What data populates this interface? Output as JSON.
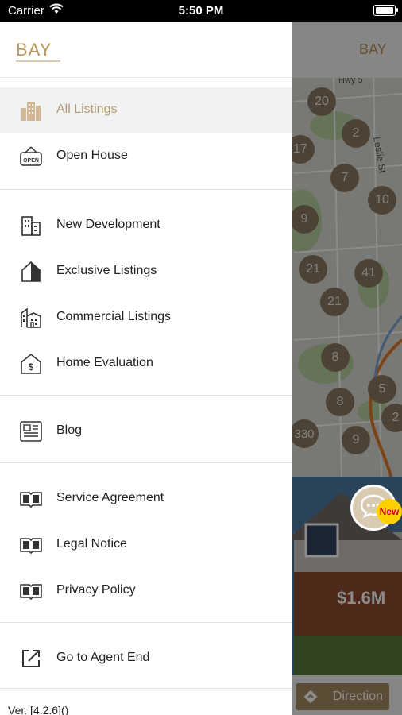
{
  "status_bar": {
    "carrier": "Carrier",
    "time": "5:50 PM"
  },
  "brand": {
    "logo_text": "BAY",
    "color": "#b8975a"
  },
  "drawer": {
    "groups": [
      {
        "items": [
          {
            "label": "All Listings",
            "icon": "building-icon",
            "selected": true
          },
          {
            "label": "Open House",
            "icon": "open-sign-icon",
            "selected": false
          }
        ]
      },
      {
        "items": [
          {
            "label": "New Development",
            "icon": "new-building-icon",
            "selected": false
          },
          {
            "label": "Exclusive Listings",
            "icon": "house-icon",
            "selected": false
          },
          {
            "label": "Commercial Listings",
            "icon": "commercial-building-icon",
            "selected": false
          },
          {
            "label": "Home Evaluation",
            "icon": "house-dollar-icon",
            "selected": false
          }
        ]
      },
      {
        "items": [
          {
            "label": "Blog",
            "icon": "newspaper-icon",
            "selected": false
          }
        ]
      },
      {
        "items": [
          {
            "label": "Service Agreement",
            "icon": "book-icon",
            "selected": false
          },
          {
            "label": "Legal Notice",
            "icon": "book-icon",
            "selected": false
          },
          {
            "label": "Privacy Policy",
            "icon": "book-icon",
            "selected": false
          }
        ]
      },
      {
        "items": [
          {
            "label": "Go to Agent End",
            "icon": "external-link-icon",
            "selected": false
          }
        ]
      }
    ],
    "version": "Ver. [4.2.6]()"
  },
  "map": {
    "street_labels": [
      "Leslie St",
      "Hwy 5"
    ],
    "clusters": [
      "20",
      "2",
      "17",
      "7",
      "10",
      "9",
      "21",
      "41",
      "21",
      "8",
      "5",
      "8",
      "2",
      "330",
      "9"
    ]
  },
  "listing": {
    "price": "$1.6M"
  },
  "chat": {
    "badge": "New"
  },
  "bottom": {
    "direction_label": "Direction"
  }
}
